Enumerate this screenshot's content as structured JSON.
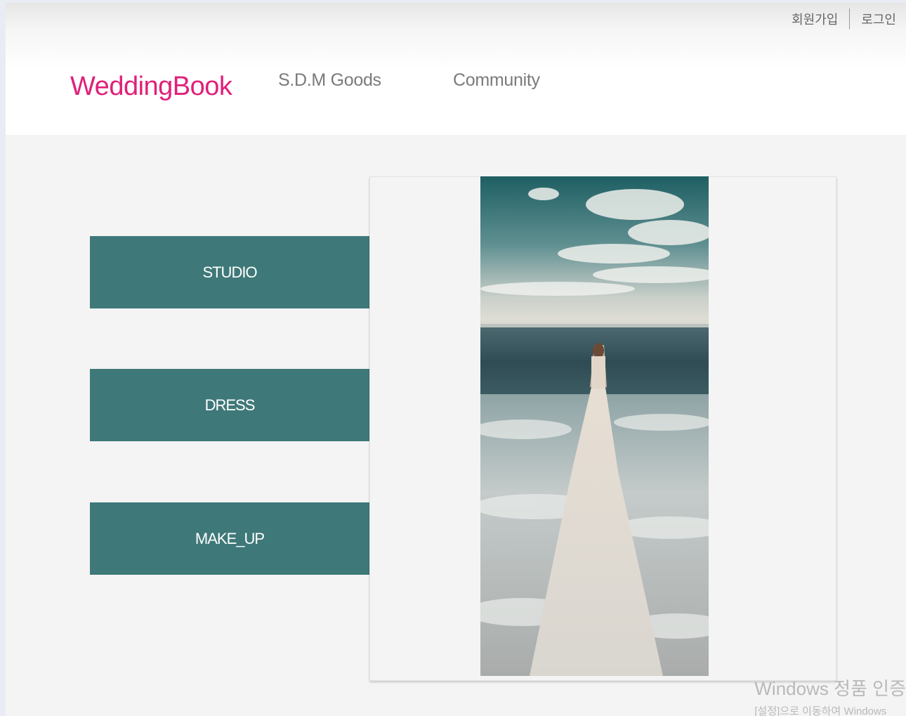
{
  "header": {
    "signup_label": "회원가입",
    "login_label": "로그인",
    "logo_text": "WeddingBook",
    "nav": {
      "goods_label": "S.D.M Goods",
      "community_label": "Community"
    }
  },
  "categories": {
    "studio_label": "STUDIO",
    "dress_label": "DRESS",
    "makeup_label": "MAKE_UP"
  },
  "watermark": {
    "title": "Windows 정품 인증",
    "subtitle": "[설정]으로 이동하여 Windows"
  },
  "colors": {
    "brand_pink": "#e0207a",
    "button_teal": "#3f7878",
    "page_bg": "#f4f4f4"
  }
}
